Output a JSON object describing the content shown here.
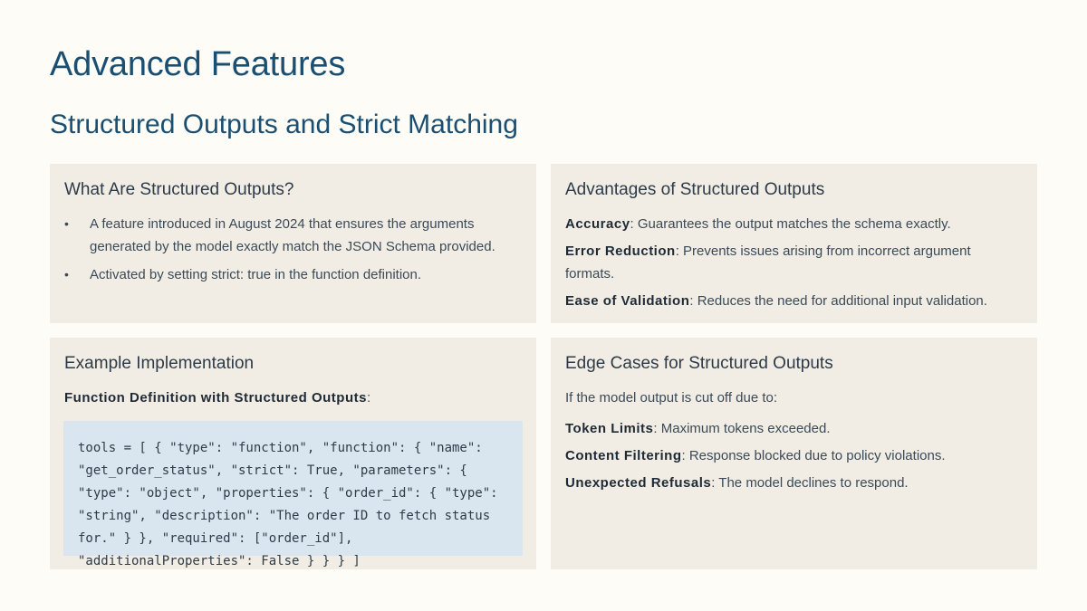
{
  "slide": {
    "title": "Advanced Features",
    "subtitle": "Structured Outputs and Strict Matching"
  },
  "card1": {
    "heading": "What Are Structured Outputs?",
    "bullets": [
      "A feature introduced in August 2024 that ensures the arguments generated by the model exactly match the JSON Schema provided.",
      "Activated by setting strict: true in the function definition."
    ]
  },
  "card2": {
    "heading": "Advantages of Structured Outputs",
    "items": [
      {
        "term": "Accuracy",
        "text": ": Guarantees the output matches the schema exactly."
      },
      {
        "term": "Error Reduction",
        "text": ": Prevents issues arising from incorrect argument formats."
      },
      {
        "term": "Ease of Validation",
        "text": ": Reduces the need for additional input validation."
      }
    ]
  },
  "card3": {
    "heading": "Example Implementation",
    "label_term": "Function Definition with Structured Outputs",
    "label_suffix": ":",
    "code": "tools = [ { \"type\": \"function\", \"function\": { \"name\": \"get_order_status\", \"strict\": True, \"parameters\": { \"type\": \"object\", \"properties\": { \"order_id\": { \"type\": \"string\", \"description\": \"The order ID to fetch status for.\" } }, \"required\": [\"order_id\"], \"additionalProperties\": False } } } ]"
  },
  "card4": {
    "heading": "Edge Cases for Structured Outputs",
    "intro": "If the model output is cut off due to:",
    "items": [
      {
        "term": "Token Limits",
        "text": ": Maximum tokens exceeded."
      },
      {
        "term": "Content Filtering",
        "text": ": Response blocked due to policy violations."
      },
      {
        "term": "Unexpected Refusals",
        "text": ": The model declines to respond."
      }
    ]
  },
  "bullet_glyph": "•"
}
